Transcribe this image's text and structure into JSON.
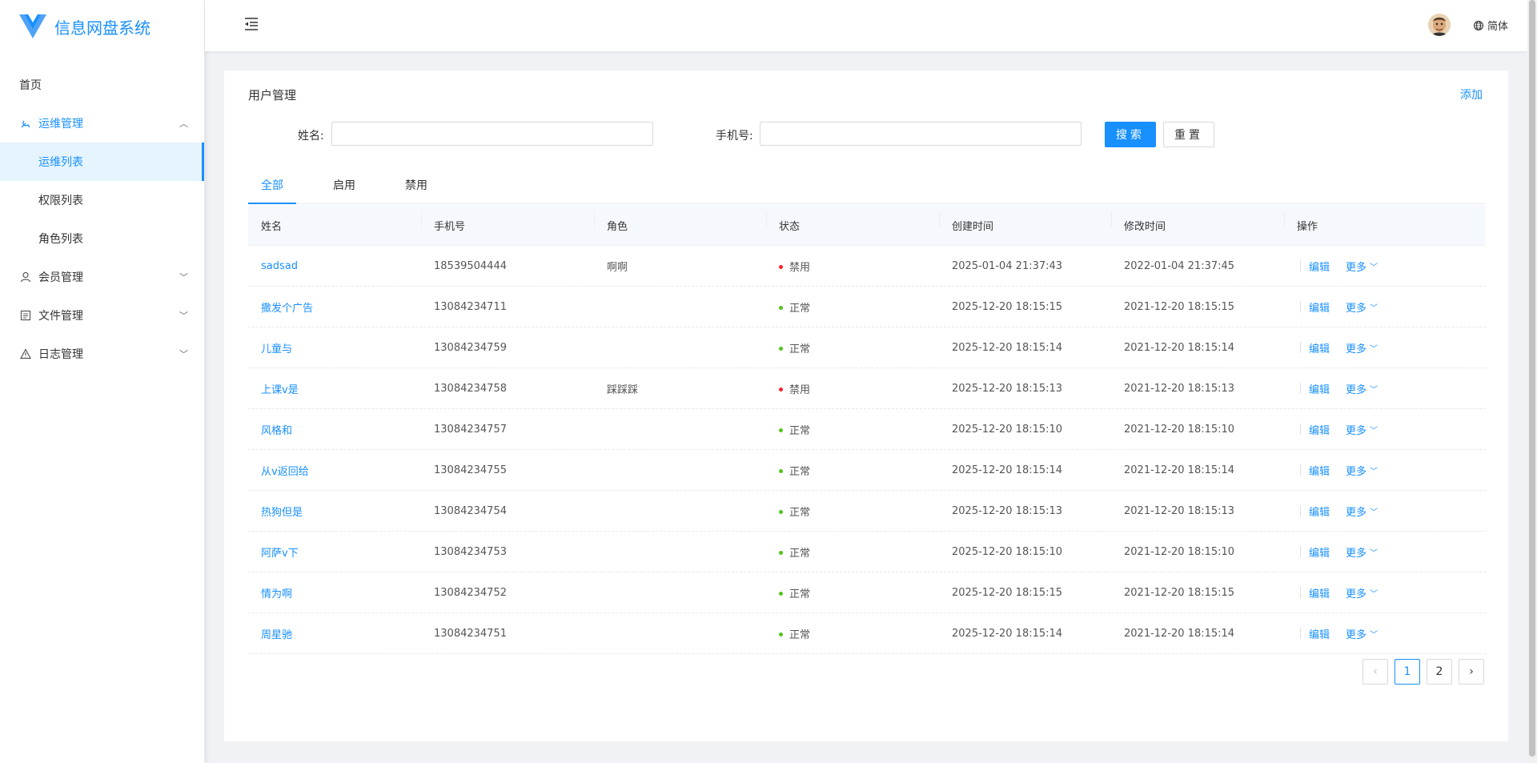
{
  "app": {
    "title": "信息网盘系统"
  },
  "sidebar": {
    "items": [
      {
        "label": "首页"
      },
      {
        "label": "运维管理",
        "children": [
          {
            "label": "运维列表"
          },
          {
            "label": "权限列表"
          },
          {
            "label": "角色列表"
          }
        ]
      },
      {
        "label": "会员管理"
      },
      {
        "label": "文件管理"
      },
      {
        "label": "日志管理"
      }
    ]
  },
  "header": {
    "lang": "简体"
  },
  "page": {
    "title": "用户管理",
    "add": "添加",
    "search": {
      "name_label": "姓名:",
      "name_value": "",
      "phone_label": "手机号:",
      "phone_value": "",
      "search_btn": "搜索",
      "reset_btn": "重置"
    },
    "tabs": [
      "全部",
      "启用",
      "禁用"
    ],
    "table": {
      "columns": [
        "姓名",
        "手机号",
        "角色",
        "状态",
        "创建时间",
        "修改时间",
        "操作"
      ],
      "rows": [
        {
          "name": "sadsad",
          "phone": "18539504444",
          "role": "啊啊",
          "status": "禁用",
          "created": "2025-01-04 21:37:43",
          "modified": "2022-01-04 21:37:45",
          "edit": "编辑",
          "more": "更多"
        },
        {
          "name": "撒发个广告",
          "phone": "13084234711",
          "role": "",
          "status": "正常",
          "created": "2025-12-20 18:15:15",
          "modified": "2021-12-20 18:15:15",
          "edit": "编辑",
          "more": "更多"
        },
        {
          "name": "儿童与",
          "phone": "13084234759",
          "role": "",
          "status": "正常",
          "created": "2025-12-20 18:15:14",
          "modified": "2021-12-20 18:15:14",
          "edit": "编辑",
          "more": "更多"
        },
        {
          "name": "上课v是",
          "phone": "13084234758",
          "role": "踩踩踩",
          "status": "禁用",
          "created": "2025-12-20 18:15:13",
          "modified": "2021-12-20 18:15:13",
          "edit": "编辑",
          "more": "更多"
        },
        {
          "name": "风格和",
          "phone": "13084234757",
          "role": "",
          "status": "正常",
          "created": "2025-12-20 18:15:10",
          "modified": "2021-12-20 18:15:10",
          "edit": "编辑",
          "more": "更多"
        },
        {
          "name": "从v返回给",
          "phone": "13084234755",
          "role": "",
          "status": "正常",
          "created": "2025-12-20 18:15:14",
          "modified": "2021-12-20 18:15:14",
          "edit": "编辑",
          "more": "更多"
        },
        {
          "name": "热狗但是",
          "phone": "13084234754",
          "role": "",
          "status": "正常",
          "created": "2025-12-20 18:15:13",
          "modified": "2021-12-20 18:15:13",
          "edit": "编辑",
          "more": "更多"
        },
        {
          "name": "阿萨v下",
          "phone": "13084234753",
          "role": "",
          "status": "正常",
          "created": "2025-12-20 18:15:10",
          "modified": "2021-12-20 18:15:10",
          "edit": "编辑",
          "more": "更多"
        },
        {
          "name": "情为啊",
          "phone": "13084234752",
          "role": "",
          "status": "正常",
          "created": "2025-12-20 18:15:15",
          "modified": "2021-12-20 18:15:15",
          "edit": "编辑",
          "more": "更多"
        },
        {
          "name": "周星驰",
          "phone": "13084234751",
          "role": "",
          "status": "正常",
          "created": "2025-12-20 18:15:14",
          "modified": "2021-12-20 18:15:14",
          "edit": "编辑",
          "more": "更多"
        }
      ]
    },
    "pagination": {
      "pages": [
        "1",
        "2"
      ],
      "current": "1",
      "prev": "‹",
      "next": "›"
    }
  },
  "colors": {
    "accent": "#1890ff",
    "status_disabled": "#f5222d",
    "status_normal": "#52c41a"
  }
}
